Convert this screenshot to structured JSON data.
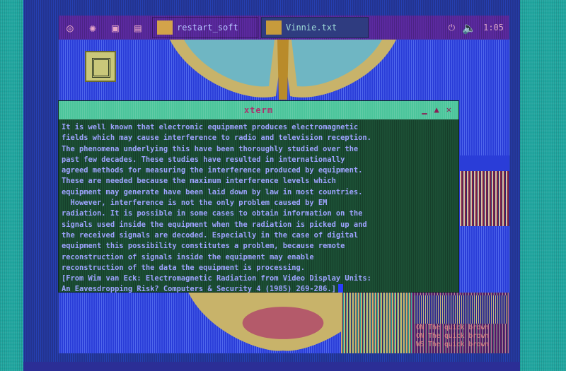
{
  "taskbar": {
    "tasks": [
      {
        "label": "restart_soft"
      },
      {
        "label": "Vinnie.txt"
      }
    ],
    "clock": "1:05"
  },
  "terminal": {
    "title": "xterm",
    "lines": [
      "It is well known that electronic equipment produces electromagnetic",
      "fields which may cause interference to radio and television reception.",
      "The phenomena underlying this have been thoroughly studied over the",
      "past few decades. These studies have resulted in internationally",
      "agreed methods for measuring the interference produced by equipment.",
      "These are needed because the maximum interference levels which",
      "equipment may generate have been laid down by law in most countries.",
      "  However, interference is not the only problem caused by EM",
      "radiation. It is possible in some cases to obtain information on the",
      "signals used inside the equipment when the radiation is picked up and",
      "the received signals are decoded. Especially in the case of digital",
      "equipment this possibility constitutes a problem, because remote",
      "reconstruction of signals inside the equipment may enable",
      "reconstruction of the data the equipment is processing.",
      "[From Wim van Eck: Electromagnetic Radiation from Video Display Units:",
      "An Eavesdropping Risk? Computers & Security 4 (1985) 269-286.]"
    ]
  },
  "bg_window": {
    "lines": [
      "ON The quick brown",
      "ON The quick brown",
      "WS The quick brown"
    ]
  },
  "colors": {
    "terminal_text": "#9ea3ff",
    "titlebar": "#4bc59b",
    "desktop": "#2a3dd8"
  },
  "icons": [
    "app-icon",
    "firefox-icon",
    "terminal-icon",
    "display-icon",
    "power-icon",
    "speaker-icon"
  ]
}
